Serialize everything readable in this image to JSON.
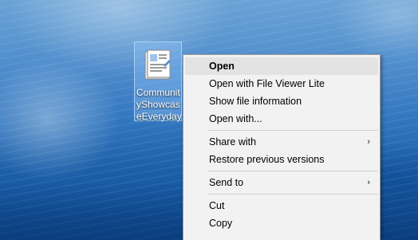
{
  "desktop_icon": {
    "label": "CommunityShowcaseEverydayArt",
    "icon": "document-file-icon"
  },
  "context_menu": {
    "items": [
      {
        "label": "Open",
        "default": true,
        "highlighted": true
      },
      {
        "label": "Open with File Viewer Lite"
      },
      {
        "label": "Show file information"
      },
      {
        "label": "Open with..."
      },
      {
        "label": "Share with",
        "submenu": true
      },
      {
        "label": "Restore previous versions"
      },
      {
        "label": "Send to",
        "submenu": true
      },
      {
        "label": "Cut"
      },
      {
        "label": "Copy"
      }
    ],
    "submenu_arrow": "›"
  },
  "colors": {
    "menu_background": "#f2f2f2",
    "menu_highlight": "#e3e3e3",
    "menu_border": "#a0a0a0",
    "desktop_blue": "#2f74bd"
  }
}
